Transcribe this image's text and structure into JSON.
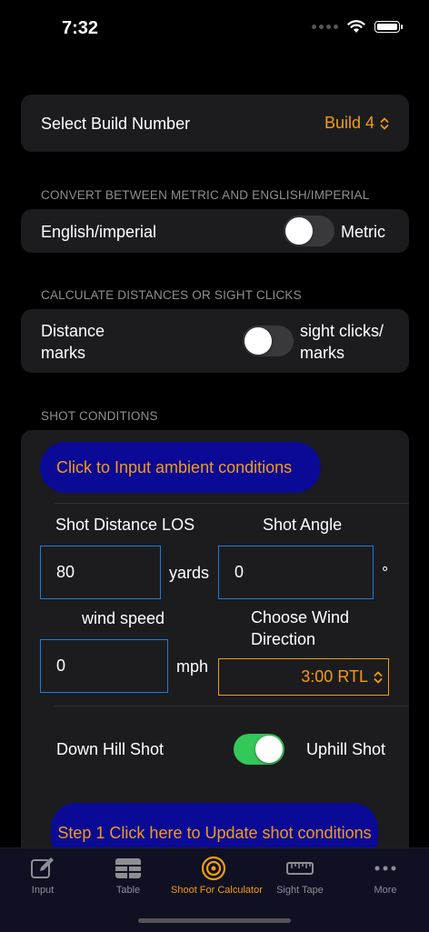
{
  "status": {
    "time": "7:32"
  },
  "build": {
    "label": "Select Build Number",
    "value": "Build 4"
  },
  "units": {
    "header": "CONVERT BETWEEN METRIC AND ENGLISH/IMPERIAL",
    "left": "English/imperial",
    "right": "Metric",
    "toggle_on": false
  },
  "mode": {
    "header": "CALCULATE DISTANCES OR SIGHT CLICKS",
    "left": "Distance marks",
    "right": "sight clicks/ marks",
    "toggle_on": false
  },
  "shot": {
    "header": "SHOT CONDITIONS",
    "ambient_button": "Click to Input ambient conditions",
    "distance_label": "Shot Distance LOS",
    "distance_value": "80",
    "distance_unit": "yards",
    "angle_label": "Shot Angle",
    "angle_value": "0",
    "angle_unit": "°",
    "wind_label": "wind speed",
    "wind_value": "0",
    "wind_unit": "mph",
    "direction_label": "Choose Wind Direction",
    "direction_value": "3:00 RTL",
    "downhill_label": "Down Hill Shot",
    "uphill_label": "Uphill Shot",
    "uphill_on": true,
    "update_button": "Step 1 Click here to Update shot conditions"
  },
  "tabs": [
    {
      "label": "Input",
      "icon": "edit-icon",
      "active": false
    },
    {
      "label": "Table",
      "icon": "table-icon",
      "active": false
    },
    {
      "label": "Shoot For Calculator",
      "icon": "target-icon",
      "active": true
    },
    {
      "label": "Sight Tape",
      "icon": "ruler-icon",
      "active": false
    },
    {
      "label": "More",
      "icon": "more-icon",
      "active": false
    }
  ],
  "colors": {
    "accent": "#f39c12",
    "button_bg": "#0a0a96",
    "field_border": "#1e7bd9",
    "toggle_on": "#34c759"
  }
}
